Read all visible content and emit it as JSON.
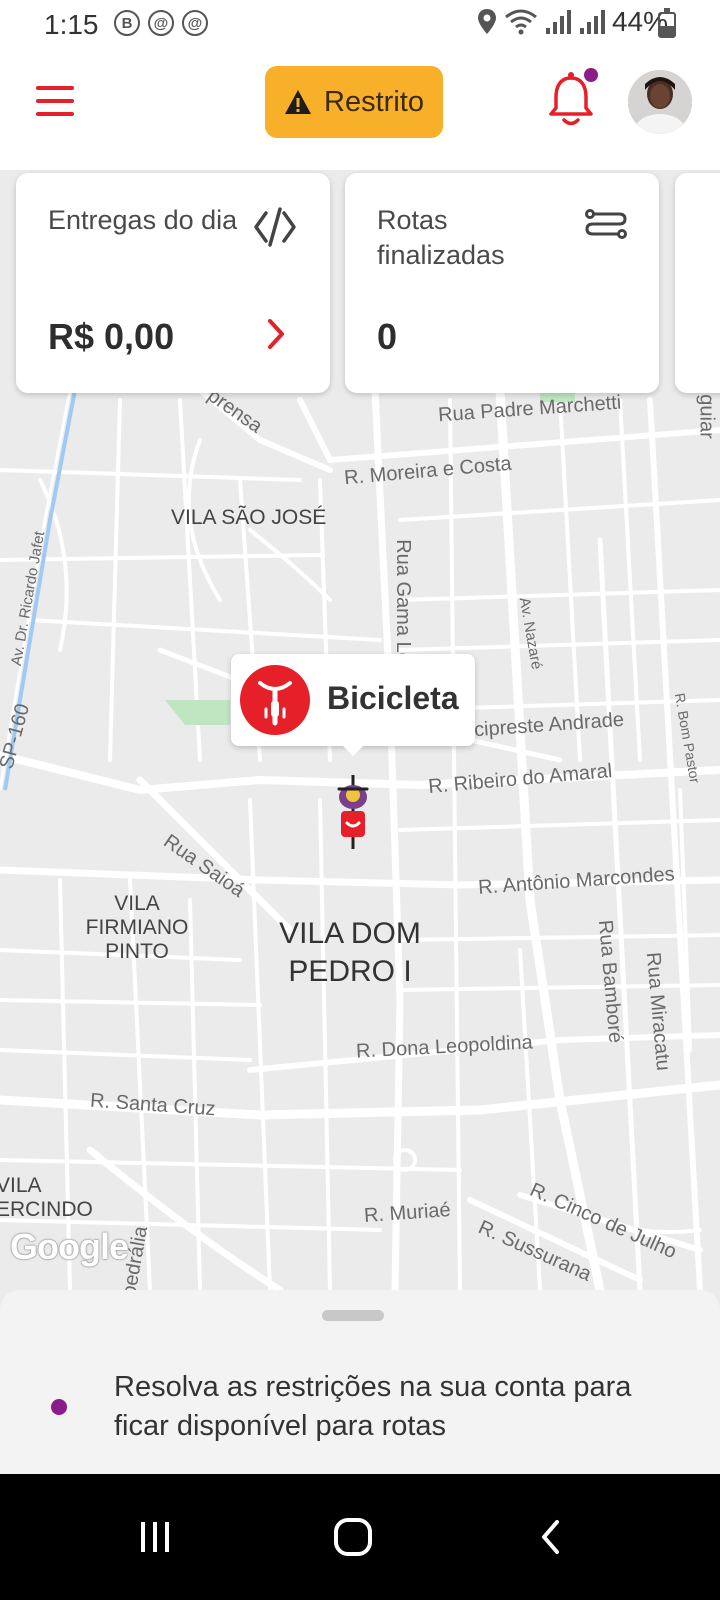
{
  "status_bar": {
    "time": "1:15",
    "notification_icons": [
      "B",
      "@",
      "@"
    ],
    "battery_text": "44%",
    "battery_level": 0.44
  },
  "top_bar": {
    "status_chip_label": "Restrito",
    "chip_color": "#f8b02a",
    "accent_color": "#e62028",
    "has_unread_notification": true
  },
  "cards": [
    {
      "title": "Entregas do dia",
      "value": "R$ 0,00",
      "icon": "money-off-icon"
    },
    {
      "title": "Rotas finalizadas",
      "value": "0",
      "icon": "route-icon"
    }
  ],
  "map": {
    "labels": [
      "Rua Padre Marchetti",
      "R. Moreira e Costa",
      "VILA SÃO JOSÉ",
      "Rua Gama Lo",
      "Av. Dr. Ricardo Jafet",
      "Av. Nazaré",
      "SP-160",
      "cipreste Andrade",
      "R. Ribeiro do Amaral",
      "R. Bom Pastor",
      "Rua Saioá",
      "VILA FIRMIANO PINTO",
      "R. Antônio Marcondes",
      "VILA DOM PEDRO I",
      "Rua Bamboré",
      "Rua Miracatu",
      "R. Dona Leopoldina",
      "R. Santa Cruz",
      "VILA ERCINDO",
      "R. Muriaé",
      "R. Cinco de Julho",
      "R. Sussurana",
      "prensa",
      "guiar",
      "pedrália"
    ],
    "attribution": "Google"
  },
  "vehicle": {
    "label": "Bicicleta"
  },
  "bottom_sheet": {
    "message": "Resolva as restrições na sua conta para ficar disponível para rotas"
  }
}
